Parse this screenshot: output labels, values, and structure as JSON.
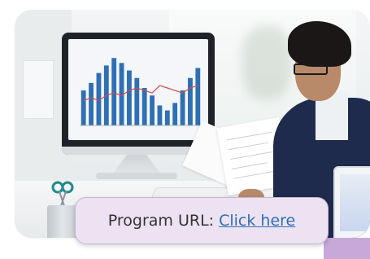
{
  "caption": {
    "label": "Program URL:",
    "link_text": "Click here"
  },
  "photo": {
    "monitor_chart": {
      "type": "bar",
      "values": [
        14,
        17,
        21,
        24,
        27,
        25,
        22,
        19,
        15,
        12,
        8,
        6,
        9,
        14,
        19,
        23
      ],
      "line_values": [
        10,
        11,
        10,
        12,
        13,
        12,
        14,
        15,
        14,
        13,
        16,
        15,
        14,
        13,
        15,
        16
      ],
      "ylim": [
        0,
        30
      ]
    }
  },
  "colors": {
    "caption_bg": "#ede2f2",
    "link": "#2f6fb3",
    "accent": "#c8a7d9",
    "bar": "#2f6fb3",
    "line": "#d24a4a"
  }
}
